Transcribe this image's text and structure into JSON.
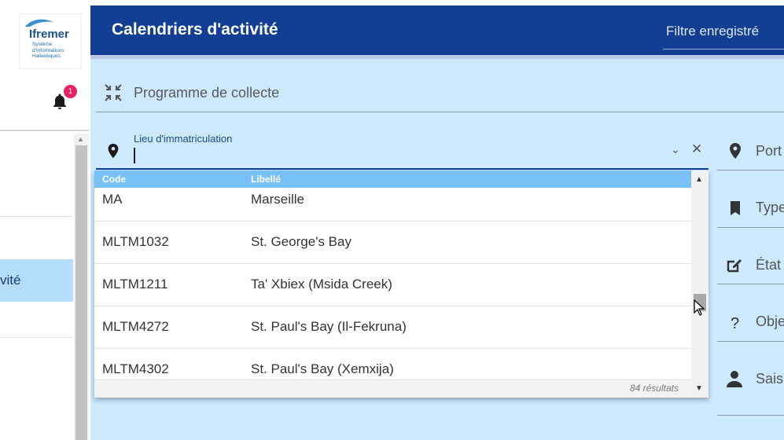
{
  "app": {
    "logo_title": "Ifremer",
    "logo_subtitle": "Système\nd'Informations\nHalieutiques",
    "notification_count": "1"
  },
  "sidebar": {
    "active_item_label": "vité"
  },
  "header": {
    "title": "Calendriers d'activité",
    "saved_filter_label": "Filtre enregistré"
  },
  "filters": {
    "programme_label": "Programme de collecte",
    "lieu_label": "Lieu d'immatriculation",
    "lieu_value": "",
    "right_fields": [
      {
        "label": "Port",
        "icon": "location-pin-icon"
      },
      {
        "label": "Type",
        "icon": "bookmark-icon"
      },
      {
        "label": "État",
        "icon": "edit-icon"
      },
      {
        "label": "Obje",
        "icon": "question-icon"
      },
      {
        "label": "Saisi",
        "icon": "person-icon"
      }
    ]
  },
  "dropdown": {
    "columns": {
      "code": "Code",
      "libelle": "Libellé"
    },
    "rows": [
      {
        "code": "MA",
        "libelle": "Marseille"
      },
      {
        "code": "MLTM1032",
        "libelle": "St. George's Bay"
      },
      {
        "code": "MLTM1211",
        "libelle": "Ta' Xbiex (Msida Creek)"
      },
      {
        "code": "MLTM4272",
        "libelle": "St. Paul's Bay (Il-Fekruna)"
      },
      {
        "code": "MLTM4302",
        "libelle": "St. Paul's Bay (Xemxija)"
      }
    ],
    "result_count": "84 résultats"
  },
  "colors": {
    "header_bg": "#123f94",
    "panel_bg": "#cce9fd",
    "dropdown_header_bg": "#77c0f8",
    "badge": "#e91e63",
    "active_nav": "#b4dcfb"
  }
}
